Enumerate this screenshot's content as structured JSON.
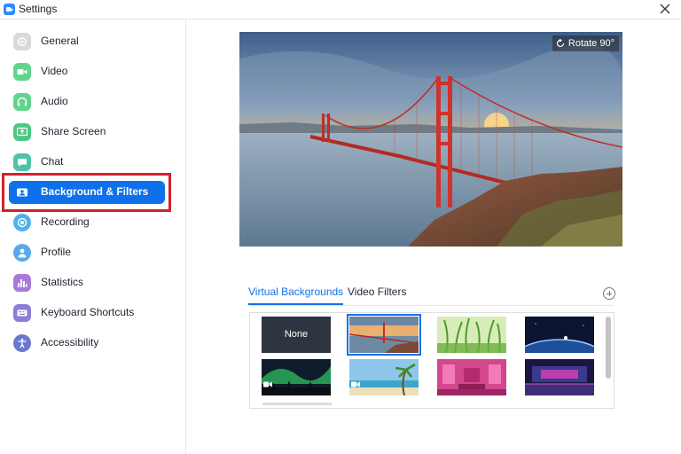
{
  "window": {
    "title": "Settings"
  },
  "sidebar": {
    "items": [
      {
        "label": "General",
        "icon": "gear-icon",
        "color": "#d9d9d9"
      },
      {
        "label": "Video",
        "icon": "video-camera-icon",
        "color": "#5fd68b"
      },
      {
        "label": "Audio",
        "icon": "headphones-icon",
        "color": "#5fd68b"
      },
      {
        "label": "Share Screen",
        "icon": "share-screen-icon",
        "color": "#4cc883"
      },
      {
        "label": "Chat",
        "icon": "chat-bubble-icon",
        "color": "#4fc3a6"
      },
      {
        "label": "Background & Filters",
        "icon": "person-card-icon",
        "color": "#ffffff",
        "active": true
      },
      {
        "label": "Recording",
        "icon": "record-icon",
        "color": "#4fb1ea"
      },
      {
        "label": "Profile",
        "icon": "person-icon",
        "color": "#59a8ec"
      },
      {
        "label": "Statistics",
        "icon": "bar-chart-icon",
        "color": "#a77ad8"
      },
      {
        "label": "Keyboard Shortcuts",
        "icon": "keyboard-icon",
        "color": "#8a7fd4"
      },
      {
        "label": "Accessibility",
        "icon": "accessibility-icon",
        "color": "#6c78cf"
      }
    ]
  },
  "preview": {
    "rotate_label": "Rotate 90°"
  },
  "tabs": {
    "virtual_backgrounds": "Virtual Backgrounds",
    "video_filters": "Video Filters",
    "active": "Virtual Backgrounds"
  },
  "backgrounds": {
    "none_label": "None",
    "items": [
      "None",
      "Golden Gate Bridge",
      "Grass",
      "Earth from space",
      "Aurora",
      "Beach with palm",
      "Pink room",
      "Stage"
    ],
    "selected": "Golden Gate Bridge"
  },
  "colors": {
    "accent": "#0e71eb",
    "highlight_border": "#d2232a"
  }
}
